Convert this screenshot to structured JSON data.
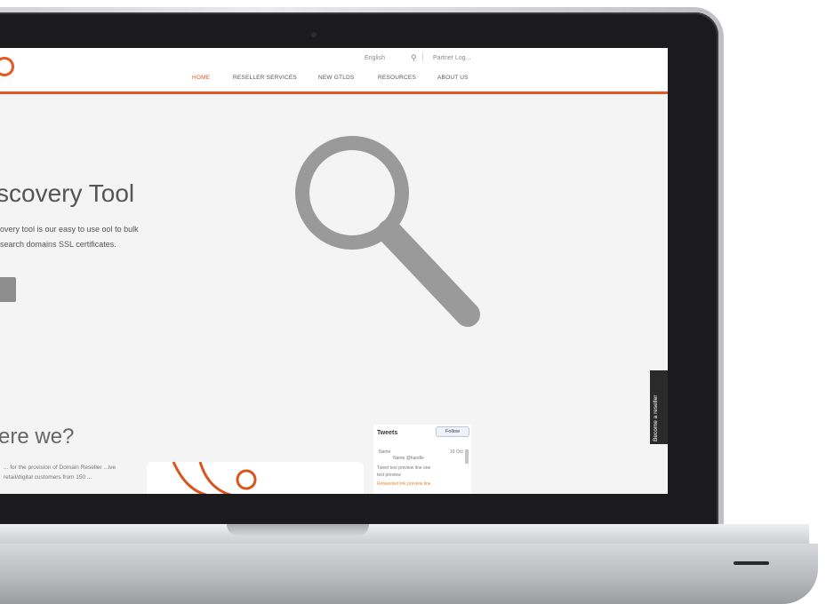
{
  "header": {
    "language_label": "English",
    "login_label": "Partner Log...",
    "nav": [
      {
        "label": "HOME",
        "active": true
      },
      {
        "label": "RESELLER SERVICES",
        "active": false
      },
      {
        "label": "NEW GTLDS",
        "active": false
      },
      {
        "label": "RESOURCES",
        "active": false
      },
      {
        "label": "ABOUT US",
        "active": false
      }
    ]
  },
  "hero": {
    "title": "scovery Tool",
    "description": "overy tool is our easy to use ool to bulk search domains SSL certificates."
  },
  "about": {
    "title": "ere we?",
    "text": "... for the provision of Domain Reseller ...ive retail/digital customers from 150 ..."
  },
  "tweets": {
    "title": "Tweets",
    "follow_label": "Follow",
    "lines": [
      {
        "text": "Name",
        "accent": false
      },
      {
        "text": "Name @handle",
        "accent": false
      },
      {
        "text": "10 Oct",
        "accent": false
      },
      {
        "text": "Tweet text preview line one",
        "accent": false
      },
      {
        "text": "text preview",
        "accent": false
      },
      {
        "text": "Retweeted link preview line",
        "accent": true
      }
    ]
  },
  "side_tab": {
    "label": "Become a reseller"
  },
  "colors": {
    "accent": "#e5581e",
    "magnifier": "#9a9a9a"
  }
}
